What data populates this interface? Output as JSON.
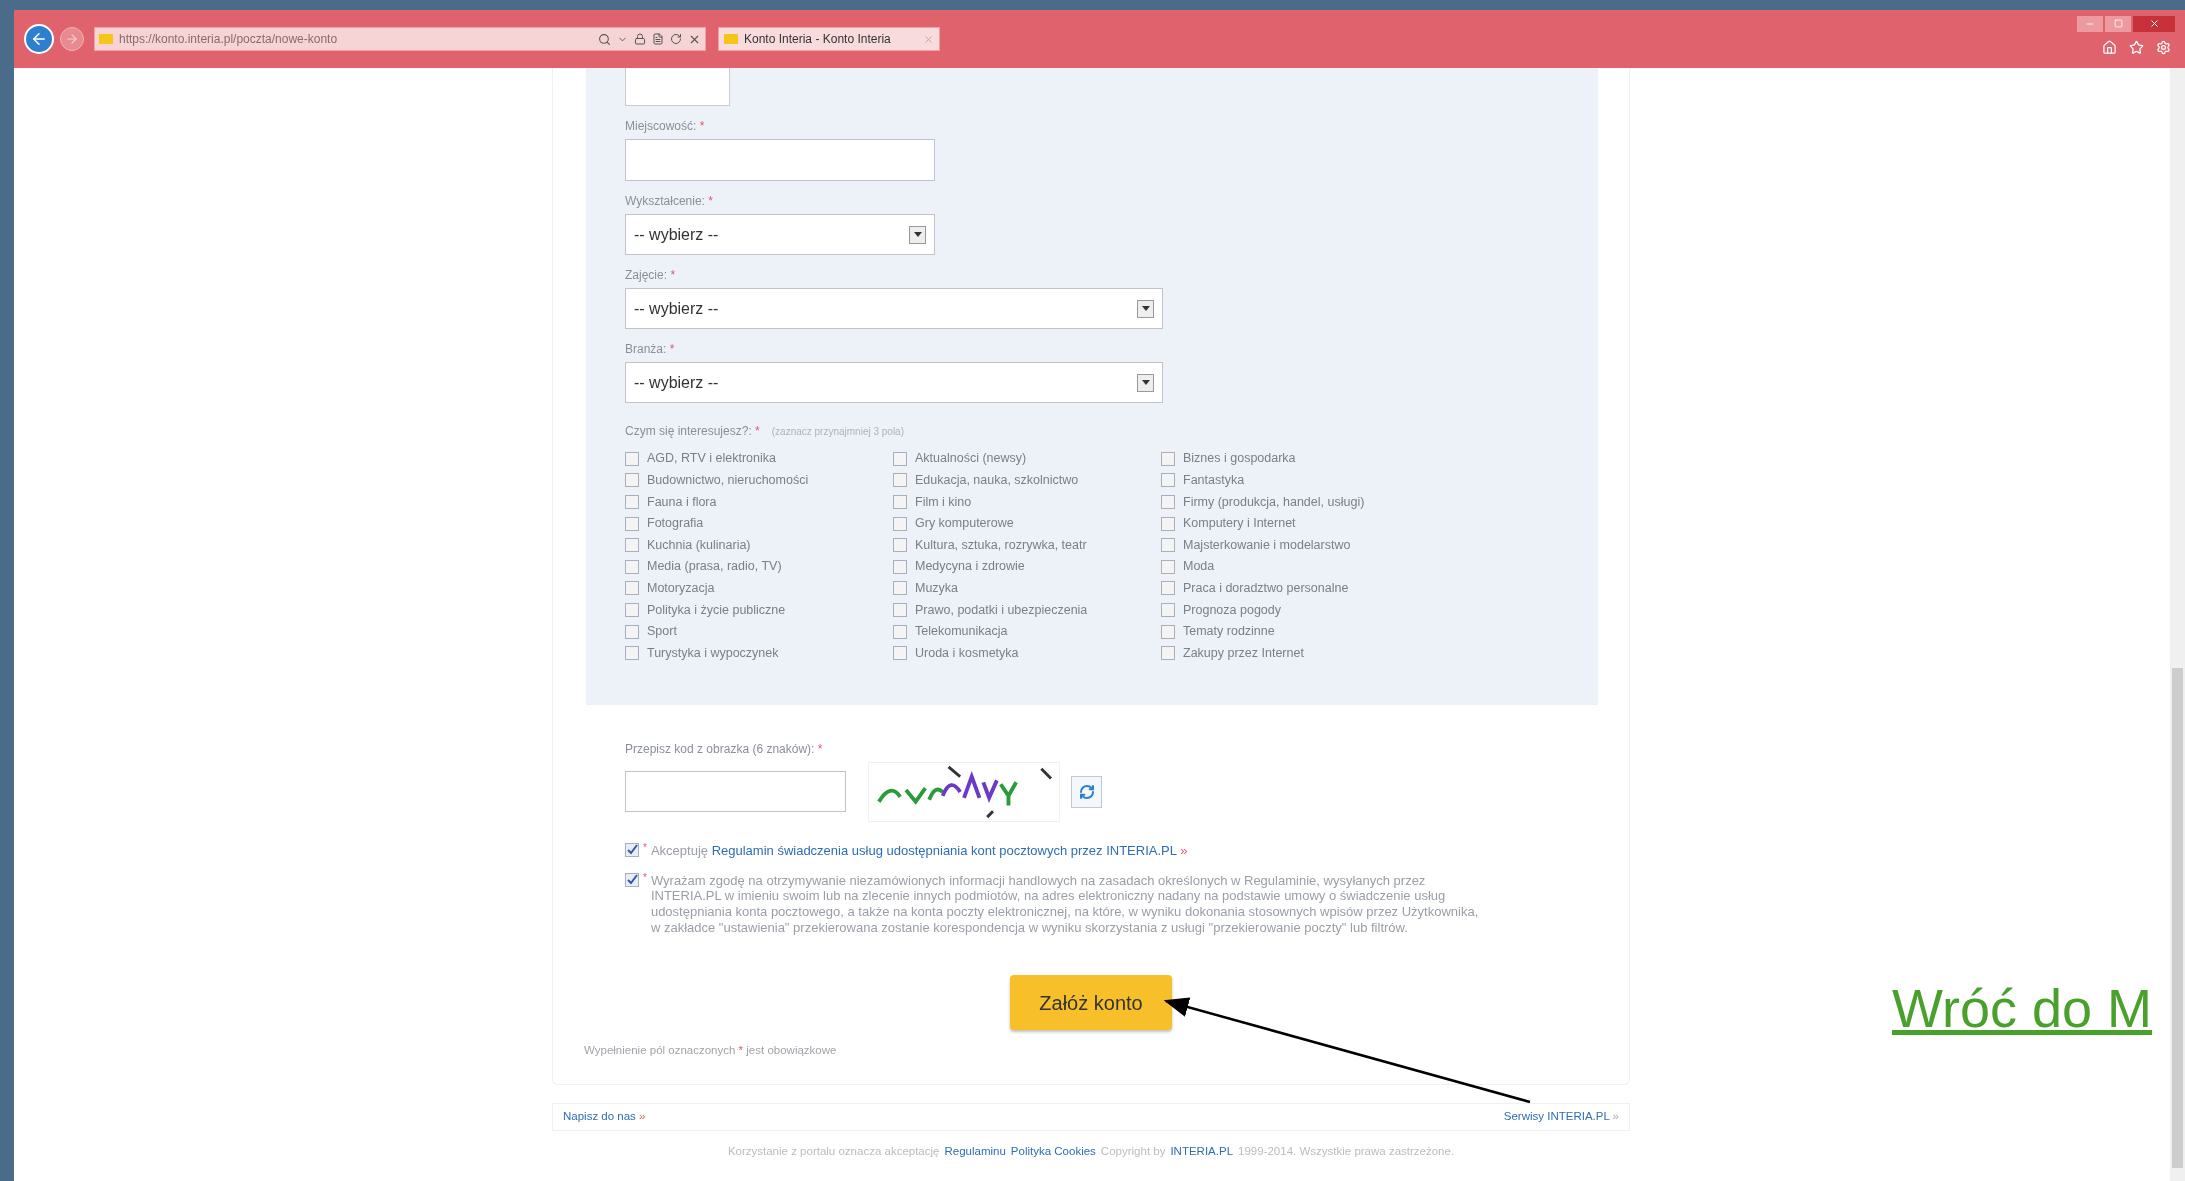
{
  "browser": {
    "url": "https://konto.interia.pl/poczta/nowe-konto",
    "tab_title": "Konto Interia - Konto Interia"
  },
  "form": {
    "fields": [
      {
        "kind": "input",
        "label": "Miejscowość:",
        "mark": "*",
        "wide": false
      },
      {
        "kind": "select",
        "label": "Wykształcenie:",
        "mark": "*",
        "wide": false,
        "value": "-- wybierz --"
      },
      {
        "kind": "select",
        "label": "Zajęcie:",
        "mark": "*",
        "wide": true,
        "value": "-- wybierz --"
      },
      {
        "kind": "select",
        "label": "Branża:",
        "mark": "*",
        "wide": true,
        "value": "-- wybierz --"
      }
    ],
    "interests": {
      "label": "Czym się interesujesz?:",
      "mark": "*",
      "hint": "(zaznacz przynajmniej 3 pola)",
      "columns": [
        [
          {
            "label": "AGD, RTV i elektronika",
            "checked": false
          },
          {
            "label": "Budownictwo, nieruchomości",
            "checked": false
          },
          {
            "label": "Fauna i flora",
            "checked": false
          },
          {
            "label": "Fotografia",
            "checked": false
          },
          {
            "label": "Kuchnia (kulinaria)",
            "checked": false
          },
          {
            "label": "Media (prasa, radio, TV)",
            "checked": false
          },
          {
            "label": "Motoryzacja",
            "checked": false
          },
          {
            "label": "Polityka i życie publiczne",
            "checked": false
          },
          {
            "label": "Sport",
            "checked": false
          },
          {
            "label": "Turystyka i wypoczynek",
            "checked": false
          }
        ],
        [
          {
            "label": "Aktualności (newsy)",
            "checked": false
          },
          {
            "label": "Edukacja, nauka, szkolnictwo",
            "checked": false
          },
          {
            "label": "Film i kino",
            "checked": false
          },
          {
            "label": "Gry komputerowe",
            "checked": false
          },
          {
            "label": "Kultura, sztuka, rozrywka, teatr",
            "checked": false
          },
          {
            "label": "Medycyna i zdrowie",
            "checked": false
          },
          {
            "label": "Muzyka",
            "checked": false
          },
          {
            "label": "Prawo, podatki i ubezpieczenia",
            "checked": false
          },
          {
            "label": "Telekomunikacja",
            "checked": false
          },
          {
            "label": "Uroda i kosmetyka",
            "checked": false
          }
        ],
        [
          {
            "label": "Biznes i gospodarka",
            "checked": false
          },
          {
            "label": "Fantastyka",
            "checked": false
          },
          {
            "label": "Firmy (produkcja, handel, usługi)",
            "checked": false
          },
          {
            "label": "Komputery i Internet",
            "checked": false
          },
          {
            "label": "Majsterkowanie i modelarstwo",
            "checked": false
          },
          {
            "label": "Moda",
            "checked": false
          },
          {
            "label": "Praca i doradztwo personalne",
            "checked": false
          },
          {
            "label": "Prognoza pogody",
            "checked": false
          },
          {
            "label": "Tematy rodzinne",
            "checked": false
          },
          {
            "label": "Zakupy przez Internet",
            "checked": false
          }
        ]
      ]
    },
    "captcha": {
      "label": "Przepisz kod z obrazka (6 znaków):",
      "mark": "*"
    },
    "consents": [
      {
        "checked": true,
        "mark": "*",
        "text": "Akceptuję",
        "link": "Regulamin świadczenia usług udostępniania kont pocztowych przez INTERIA.PL",
        "link_suffix": "»"
      },
      {
        "checked": true,
        "mark": "*",
        "text": "Wyrażam zgodę na otrzymywanie niezamówionych informacji handlowych na zasadach określonych w Regulaminie, wysyłanych przez INTERIA.PL w imieniu swoim lub na zlecenie innych podmiotów, na adres elektroniczny nadany na podstawie umowy o świadczenie usług udostępniania konta pocztowego, a także na konta poczty elektronicznej, na które, w wyniku dokonania stosownych wpisów przez Użytkownika, w zakładce \"ustawienia\" przekierowana zostanie korespondencja w wyniku skorzystania z usługi \"przekierowanie poczty\" lub filtrów."
      }
    ],
    "submit_button": "Załóż konto",
    "required_note": {
      "before": "Wypełnienie pól oznaczonych",
      "mark": "*",
      "after": "jest obowiązkowe"
    }
  },
  "footer": {
    "left_link": "Napisz do nas",
    "left_suffix": "»",
    "right_link": "Serwisy INTERIA.PL",
    "right_suffix": "»",
    "bottom": [
      {
        "kind": "text",
        "text": "Korzystanie z portalu oznacza akceptację"
      },
      {
        "kind": "link",
        "text": "Regulaminu"
      },
      {
        "kind": "link",
        "text": "Polityka Cookies"
      },
      {
        "kind": "text",
        "text": "Copyright by"
      },
      {
        "kind": "link",
        "text": "INTERIA.PL"
      },
      {
        "kind": "text",
        "text": "1999-2014. Wszystkie prawa zastrzeżone."
      }
    ]
  },
  "slide_link": "Wróć do M"
}
